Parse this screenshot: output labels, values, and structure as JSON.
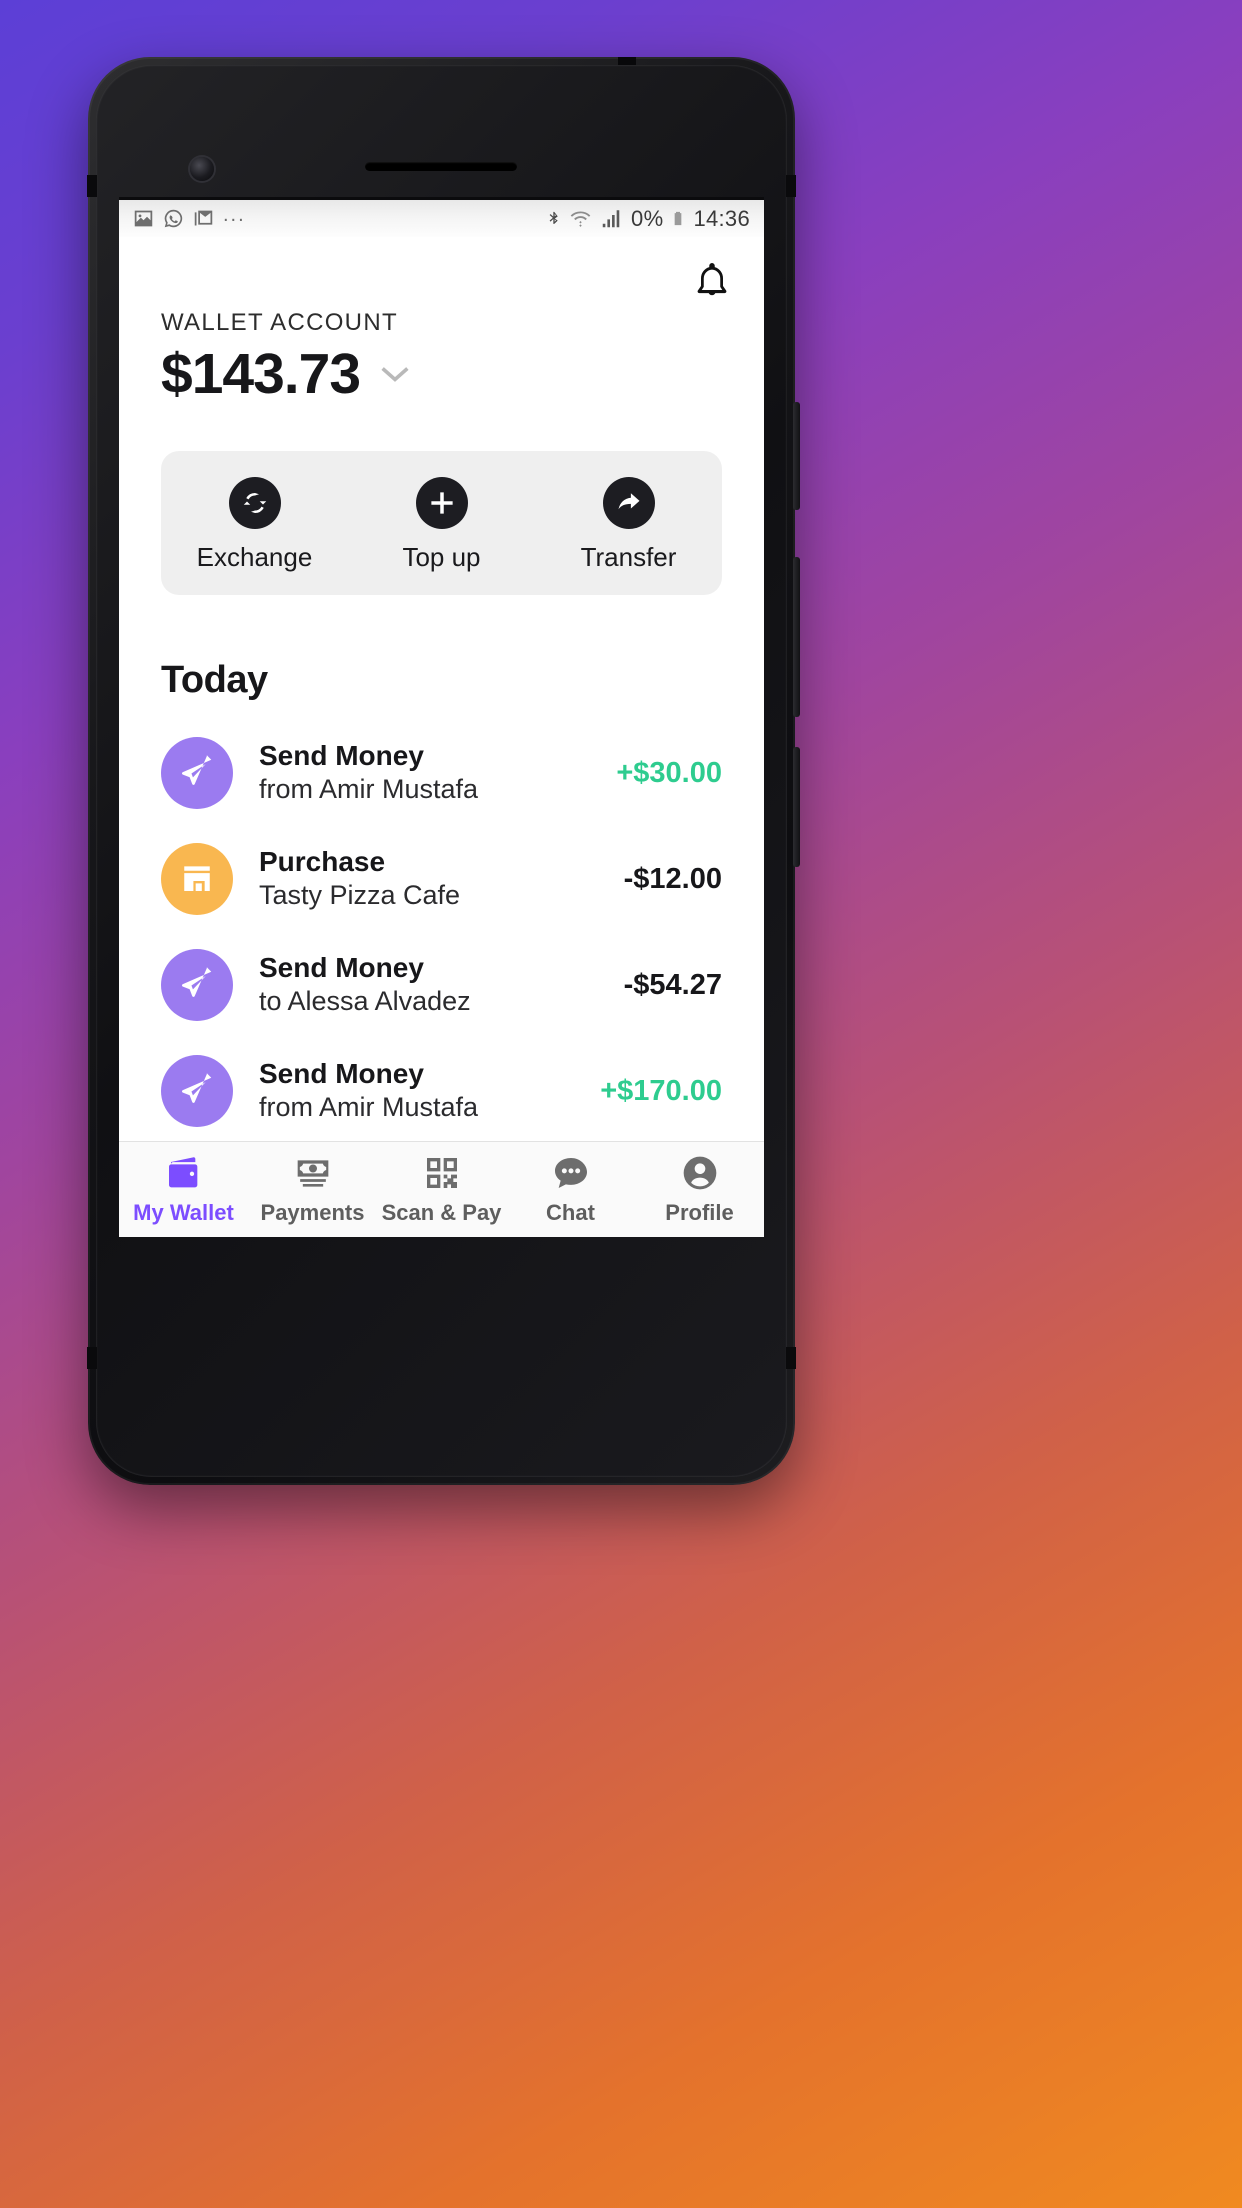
{
  "status_bar": {
    "left_icons": [
      "image-icon",
      "whatsapp-icon",
      "gmail-icon"
    ],
    "overflow": "...",
    "right_icons": [
      "bluetooth-icon",
      "wifi-icon",
      "signal-icon",
      "battery-icon"
    ],
    "battery_percent": "0%",
    "time": "14:36"
  },
  "header": {
    "notification_icon": "bell-icon"
  },
  "account": {
    "label": "WALLET ACCOUNT",
    "balance": "$143.73",
    "chevron": "chevron-down-icon"
  },
  "actions": [
    {
      "label": "Exchange",
      "icon": "exchange-icon"
    },
    {
      "label": "Top up",
      "icon": "plus-icon"
    },
    {
      "label": "Transfer",
      "icon": "share-arrow-icon"
    }
  ],
  "transactions": {
    "section_title": "Today",
    "items": [
      {
        "title": "Send Money",
        "subtitle": "from Amir Mustafa",
        "amount": "+$30.00",
        "direction": "positive",
        "icon": "send-plane-icon",
        "icon_color": "#9b7bf0"
      },
      {
        "title": "Purchase",
        "subtitle": "Tasty Pizza Cafe",
        "amount": "-$12.00",
        "direction": "negative",
        "icon": "store-icon",
        "icon_color": "#f9b750"
      },
      {
        "title": "Send Money",
        "subtitle": "to Alessa Alvadez",
        "amount": "-$54.27",
        "direction": "negative",
        "icon": "send-plane-icon",
        "icon_color": "#9b7bf0"
      },
      {
        "title": "Send Money",
        "subtitle": "from Amir Mustafa",
        "amount": "+$170.00",
        "direction": "positive",
        "icon": "send-plane-icon",
        "icon_color": "#9b7bf0"
      }
    ]
  },
  "bottom_nav": {
    "items": [
      {
        "label": "My Wallet",
        "icon": "wallet-icon",
        "active": true
      },
      {
        "label": "Payments",
        "icon": "money-icon",
        "active": false
      },
      {
        "label": "Scan & Pay",
        "icon": "qr-code-icon",
        "active": false
      },
      {
        "label": "Chat",
        "icon": "chat-icon",
        "active": false
      },
      {
        "label": "Profile",
        "icon": "person-icon",
        "active": false
      }
    ]
  },
  "colors": {
    "accent_purple": "#7c4dff",
    "positive_green": "#2ecc8f",
    "avatar_purple": "#9b7bf0",
    "avatar_orange": "#f9b750"
  }
}
